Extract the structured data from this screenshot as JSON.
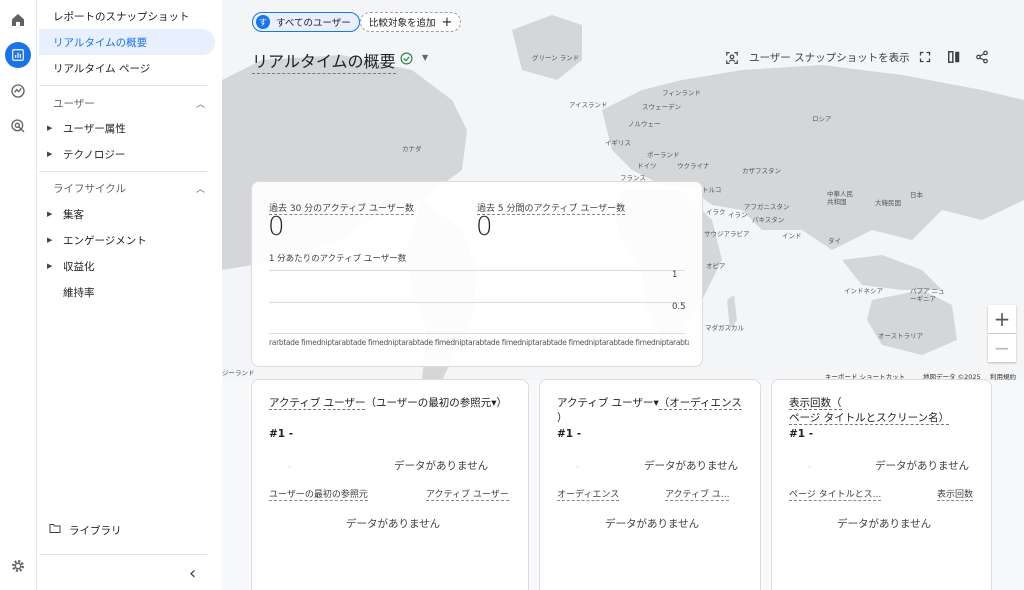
{
  "rail": {
    "items": [
      {
        "icon": "home-icon"
      },
      {
        "icon": "reports-icon",
        "active": true
      },
      {
        "icon": "explore-icon"
      },
      {
        "icon": "advertising-icon"
      },
      {
        "icon": "gear-icon"
      }
    ]
  },
  "nav": {
    "snapshot": "レポートのスナップショット",
    "realtime_overview": "リアルタイムの概要",
    "realtime_page": "リアルタイム ページ",
    "user_section": "ユーザー",
    "user_attributes": "ユーザー属性",
    "technology": "テクノロジー",
    "lifecycle_section": "ライフサイクル",
    "acquisition": "集客",
    "engagement": "エンゲージメント",
    "monetization": "収益化",
    "retention": "維持率",
    "library": "ライブラリ",
    "collapse": "‹"
  },
  "header": {
    "segment_avatar": "す",
    "segment_label": "すべてのユーザー",
    "add_compare": "比較対象を追加",
    "add_compare_plus": "+",
    "title": "リアルタイムの概要",
    "view_user_snapshot": "ユーザー スナップショットを表示"
  },
  "map": {
    "labels": [
      "グリーン ランド",
      "フィンランド",
      "アイスランド",
      "スウェーデン",
      "ノルウェー",
      "ロシア",
      "イギリス",
      "ポーランド",
      "ドイツ",
      "ウクライナ",
      "フランス",
      "カナダ",
      "カザフスタン",
      "トルコ",
      "中華人民 共和国",
      "日本",
      "イラク",
      "アフガニスタン",
      "イラン",
      "パキスタン",
      "大韓民国",
      "サウジアラビア",
      "インド",
      "タイ",
      "オピア",
      "インドネシア",
      "パプア ニューギニア",
      "マダガスカル",
      "オーストラリア",
      "ジーランド"
    ],
    "zoom_in": "+",
    "zoom_out": "−",
    "footer_shortcuts": "キーボード ショートカット",
    "footer_data": "地図データ ©2025",
    "footer_terms": "利用規約"
  },
  "realtime": {
    "active_30_label": "過去 30 分のアクティブ ユーザー数",
    "active_30_value": "0",
    "active_5_label": "過去 5 分間のアクティブ ユーザー数",
    "active_5_value": "0",
    "per_minute_label": "1 分あたりのアクティブ ユーザー数",
    "tick_1": "1",
    "tick_05": "0.5",
    "x_axis_text": "rarbtade fimedniptarabtade fimedniptarabtade fimedniptarabtade fimedniptarabtade fimedniptarabtade fimedniptarabtade fimedniptarabtade fimedniptarabtade fimedniprameter - minut"
  },
  "cards": [
    {
      "title_part1": "アクティブ ユーザー",
      "title_part2": "（ユーザーの最初の参照元▾）",
      "rank": "#1 -",
      "nodata_top": "データがありません",
      "col_left": "ユーザーの最初の参照元",
      "col_right": "アクティブ ユーザー",
      "nodata_bottom": "データがありません"
    },
    {
      "title_part1": "アクティブ ユーザー▾",
      "title_part2": "（オーディエンス",
      "title_part3": "）",
      "rank": "#1 -",
      "nodata_top": "データがありません",
      "col_left": "オーディエンス",
      "col_right": "アクティブ ユ...",
      "nodata_bottom": "データがありません"
    },
    {
      "title_part1": "表示回数（",
      "title_part2": "ページ タイトルとスクリーン名）",
      "rank": "#1 -",
      "nodata_top": "データがありません",
      "col_left": "ページ タイトルとス...",
      "col_right": "表示回数",
      "nodata_bottom": "データがありません"
    }
  ]
}
